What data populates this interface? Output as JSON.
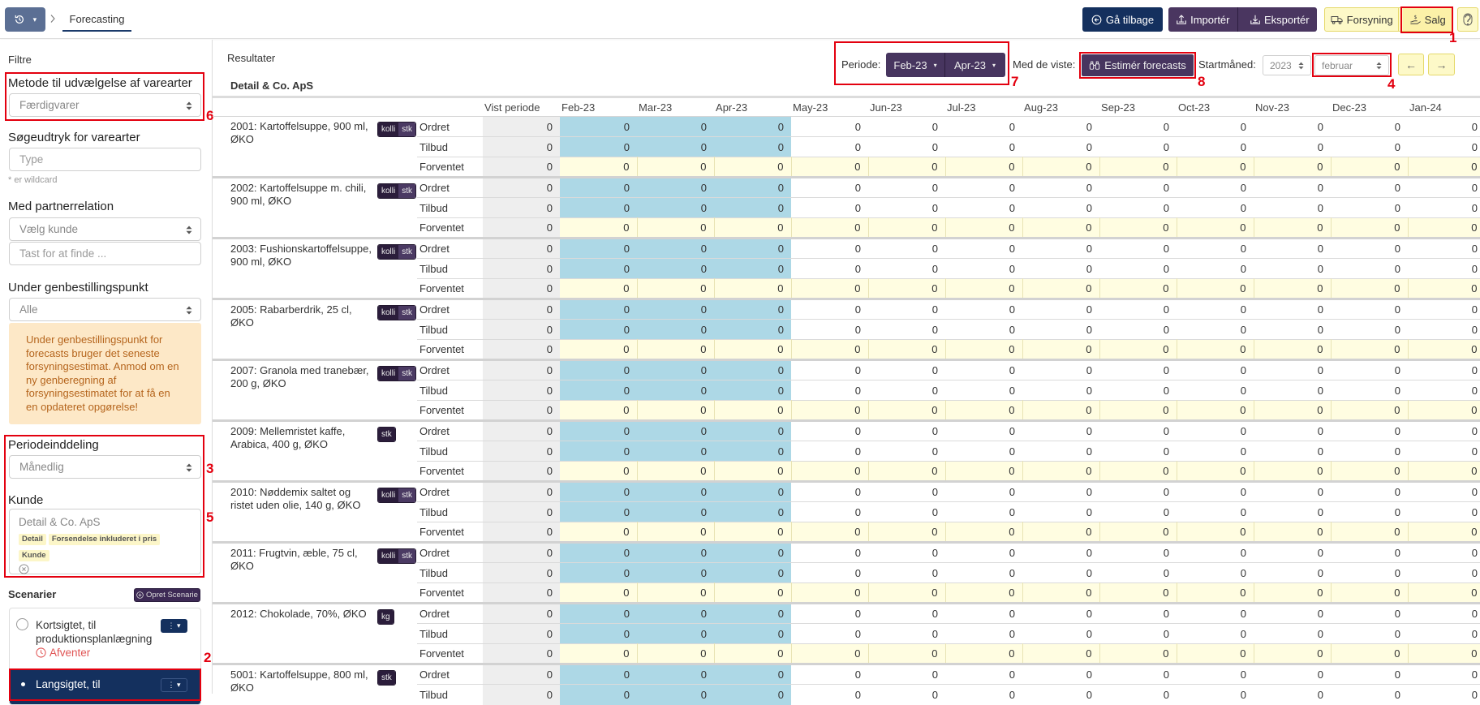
{
  "topbar": {
    "history_caret": "▾",
    "breadcrumb_separator": ">",
    "active_tab": "Forecasting",
    "back_label": "Gå tilbage",
    "import_label": "Importér",
    "export_label": "Eksportér",
    "supply_label": "Forsyning",
    "sales_label": "Salg"
  },
  "annotations": {
    "m1": "1",
    "m2": "2",
    "m3": "3",
    "m4": "4",
    "m5": "5",
    "m6": "6",
    "m7": "7",
    "m8": "8"
  },
  "sidebar": {
    "title": "Filtre",
    "method": {
      "label": "Metode til udvælgelse af varearter",
      "value": "Færdigvarer"
    },
    "search": {
      "label": "Søgeudtryk for varearter",
      "placeholder": "Type",
      "hint": "* er wildcard"
    },
    "partner": {
      "label": "Med partnerrelation",
      "select_value": "Vælg kunde",
      "search_placeholder": "Tast for at finde ..."
    },
    "reorder": {
      "label": "Under genbestillingspunkt",
      "value": "Alle",
      "warning": "Under genbestillingspunkt for forecasts bruger det seneste forsyningsestimat. Anmod om en ny genberegning af forsyningsestimatet for at få en en opdateret opgørelse!"
    },
    "period_division": {
      "label": "Periodeinddeling",
      "value": "Månedlig"
    },
    "customer": {
      "label": "Kunde",
      "value": "Detail & Co. ApS",
      "tags": [
        "Detail",
        "Forsendelse inkluderet i pris",
        "Kunde"
      ]
    },
    "scenarios": {
      "title": "Scenarier",
      "create_label": "Opret Scenarie",
      "items": [
        {
          "name": "Kortsigtet, til produktionsplanlægning",
          "status": "Afventer",
          "selected": false,
          "action": "⋮ ▾"
        },
        {
          "name": "Langsigtet, til",
          "selected": true,
          "action": "⋮ ▾"
        }
      ]
    }
  },
  "main": {
    "title": "Resultater",
    "period": {
      "label": "Periode:",
      "from": "Feb-23",
      "to": "Apr-23",
      "caret": "▾"
    },
    "with_shown": {
      "label": "Med de viste:",
      "estimate_label": "Estimér forecasts"
    },
    "start_month": {
      "label": "Startmåned:",
      "year": "2023",
      "month": "februar",
      "prev": "←",
      "next": "→"
    },
    "customer_heading": "Detail & Co. ApS"
  },
  "table": {
    "columns": [
      "Vist periode",
      "Feb-23",
      "Mar-23",
      "Apr-23",
      "May-23",
      "Jun-23",
      "Jul-23",
      "Aug-23",
      "Sep-23",
      "Oct-23",
      "Nov-23",
      "Dec-23",
      "Jan-24"
    ],
    "highlighted_months": [
      "Feb-23",
      "Mar-23",
      "Apr-23"
    ],
    "products": [
      {
        "name": "2001: Kartoffelsuppe, 900 ml, ØKO",
        "units": [
          "kolli",
          "stk"
        ],
        "rows": [
          {
            "label": "Ordret",
            "type": "ordered",
            "values": [
              0,
              0,
              0,
              0,
              0,
              0,
              0,
              0,
              0,
              0,
              0,
              0,
              0
            ]
          },
          {
            "label": "Tilbud",
            "type": "offer",
            "values": [
              0,
              0,
              0,
              0,
              0,
              0,
              0,
              0,
              0,
              0,
              0,
              0,
              0
            ]
          },
          {
            "label": "Forventet",
            "type": "expected",
            "values": [
              0,
              0,
              0,
              0,
              0,
              0,
              0,
              0,
              0,
              0,
              0,
              0,
              0
            ]
          }
        ]
      },
      {
        "name": "2002: Kartoffelsuppe m. chili, 900 ml, ØKO",
        "units": [
          "kolli",
          "stk"
        ],
        "rows": [
          {
            "label": "Ordret",
            "type": "ordered",
            "values": [
              0,
              0,
              0,
              0,
              0,
              0,
              0,
              0,
              0,
              0,
              0,
              0,
              0
            ]
          },
          {
            "label": "Tilbud",
            "type": "offer",
            "values": [
              0,
              0,
              0,
              0,
              0,
              0,
              0,
              0,
              0,
              0,
              0,
              0,
              0
            ]
          },
          {
            "label": "Forventet",
            "type": "expected",
            "values": [
              0,
              0,
              0,
              0,
              0,
              0,
              0,
              0,
              0,
              0,
              0,
              0,
              0
            ]
          }
        ]
      },
      {
        "name": "2003: Fushionskartoffelsuppe, 900 ml, ØKO",
        "units": [
          "kolli",
          "stk"
        ],
        "rows": [
          {
            "label": "Ordret",
            "type": "ordered",
            "values": [
              0,
              0,
              0,
              0,
              0,
              0,
              0,
              0,
              0,
              0,
              0,
              0,
              0
            ]
          },
          {
            "label": "Tilbud",
            "type": "offer",
            "values": [
              0,
              0,
              0,
              0,
              0,
              0,
              0,
              0,
              0,
              0,
              0,
              0,
              0
            ]
          },
          {
            "label": "Forventet",
            "type": "expected",
            "values": [
              0,
              0,
              0,
              0,
              0,
              0,
              0,
              0,
              0,
              0,
              0,
              0,
              0
            ]
          }
        ]
      },
      {
        "name": "2005: Rabarberdrik, 25 cl, ØKO",
        "units": [
          "kolli",
          "stk"
        ],
        "rows": [
          {
            "label": "Ordret",
            "type": "ordered",
            "values": [
              0,
              0,
              0,
              0,
              0,
              0,
              0,
              0,
              0,
              0,
              0,
              0,
              0
            ]
          },
          {
            "label": "Tilbud",
            "type": "offer",
            "values": [
              0,
              0,
              0,
              0,
              0,
              0,
              0,
              0,
              0,
              0,
              0,
              0,
              0
            ]
          },
          {
            "label": "Forventet",
            "type": "expected",
            "values": [
              0,
              0,
              0,
              0,
              0,
              0,
              0,
              0,
              0,
              0,
              0,
              0,
              0
            ]
          }
        ]
      },
      {
        "name": "2007: Granola med tranebær, 200 g, ØKO",
        "units": [
          "kolli",
          "stk"
        ],
        "rows": [
          {
            "label": "Ordret",
            "type": "ordered",
            "values": [
              0,
              0,
              0,
              0,
              0,
              0,
              0,
              0,
              0,
              0,
              0,
              0,
              0
            ]
          },
          {
            "label": "Tilbud",
            "type": "offer",
            "values": [
              0,
              0,
              0,
              0,
              0,
              0,
              0,
              0,
              0,
              0,
              0,
              0,
              0
            ]
          },
          {
            "label": "Forventet",
            "type": "expected",
            "values": [
              0,
              0,
              0,
              0,
              0,
              0,
              0,
              0,
              0,
              0,
              0,
              0,
              0
            ]
          }
        ]
      },
      {
        "name": "2009: Mellemristet kaffe, Arabica, 400 g, ØKO",
        "units": [
          "stk"
        ],
        "rows": [
          {
            "label": "Ordret",
            "type": "ordered",
            "values": [
              0,
              0,
              0,
              0,
              0,
              0,
              0,
              0,
              0,
              0,
              0,
              0,
              0
            ]
          },
          {
            "label": "Tilbud",
            "type": "offer",
            "values": [
              0,
              0,
              0,
              0,
              0,
              0,
              0,
              0,
              0,
              0,
              0,
              0,
              0
            ]
          },
          {
            "label": "Forventet",
            "type": "expected",
            "values": [
              0,
              0,
              0,
              0,
              0,
              0,
              0,
              0,
              0,
              0,
              0,
              0,
              0
            ]
          }
        ]
      },
      {
        "name": "2010: Nøddemix saltet og ristet uden olie, 140 g, ØKO",
        "units": [
          "kolli",
          "stk"
        ],
        "rows": [
          {
            "label": "Ordret",
            "type": "ordered",
            "values": [
              0,
              0,
              0,
              0,
              0,
              0,
              0,
              0,
              0,
              0,
              0,
              0,
              0
            ]
          },
          {
            "label": "Tilbud",
            "type": "offer",
            "values": [
              0,
              0,
              0,
              0,
              0,
              0,
              0,
              0,
              0,
              0,
              0,
              0,
              0
            ]
          },
          {
            "label": "Forventet",
            "type": "expected",
            "values": [
              0,
              0,
              0,
              0,
              0,
              0,
              0,
              0,
              0,
              0,
              0,
              0,
              0
            ]
          }
        ]
      },
      {
        "name": "2011: Frugtvin, æble, 75 cl, ØKO",
        "units": [
          "kolli",
          "stk"
        ],
        "rows": [
          {
            "label": "Ordret",
            "type": "ordered",
            "values": [
              0,
              0,
              0,
              0,
              0,
              0,
              0,
              0,
              0,
              0,
              0,
              0,
              0
            ]
          },
          {
            "label": "Tilbud",
            "type": "offer",
            "values": [
              0,
              0,
              0,
              0,
              0,
              0,
              0,
              0,
              0,
              0,
              0,
              0,
              0
            ]
          },
          {
            "label": "Forventet",
            "type": "expected",
            "values": [
              0,
              0,
              0,
              0,
              0,
              0,
              0,
              0,
              0,
              0,
              0,
              0,
              0
            ]
          }
        ]
      },
      {
        "name": "2012: Chokolade, 70%, ØKO",
        "units": [
          "kg"
        ],
        "rows": [
          {
            "label": "Ordret",
            "type": "ordered",
            "values": [
              0,
              0,
              0,
              0,
              0,
              0,
              0,
              0,
              0,
              0,
              0,
              0,
              0
            ]
          },
          {
            "label": "Tilbud",
            "type": "offer",
            "values": [
              0,
              0,
              0,
              0,
              0,
              0,
              0,
              0,
              0,
              0,
              0,
              0,
              0
            ]
          },
          {
            "label": "Forventet",
            "type": "expected",
            "values": [
              0,
              0,
              0,
              0,
              0,
              0,
              0,
              0,
              0,
              0,
              0,
              0,
              0
            ]
          }
        ]
      },
      {
        "name": "5001: Kartoffelsuppe, 800 ml, ØKO",
        "units": [
          "stk"
        ],
        "rows": [
          {
            "label": "Ordret",
            "type": "ordered",
            "values": [
              0,
              0,
              0,
              0,
              0,
              0,
              0,
              0,
              0,
              0,
              0,
              0,
              0
            ]
          },
          {
            "label": "Tilbud",
            "type": "offer",
            "values": [
              0,
              0,
              0,
              0,
              0,
              0,
              0,
              0,
              0,
              0,
              0,
              0,
              0
            ]
          }
        ]
      }
    ]
  },
  "colors": {
    "navy": "#14305e",
    "purple": "#47355f",
    "yellow_button": "#fdf9c8",
    "period_highlight": "#add8e6",
    "expected_row": "#fffde1",
    "shown_period": "#eeeeee",
    "warning_bg": "#fde8c7",
    "warning_text": "#b5651d",
    "annotation": "#e3000f",
    "status_pending": "#e05555"
  }
}
